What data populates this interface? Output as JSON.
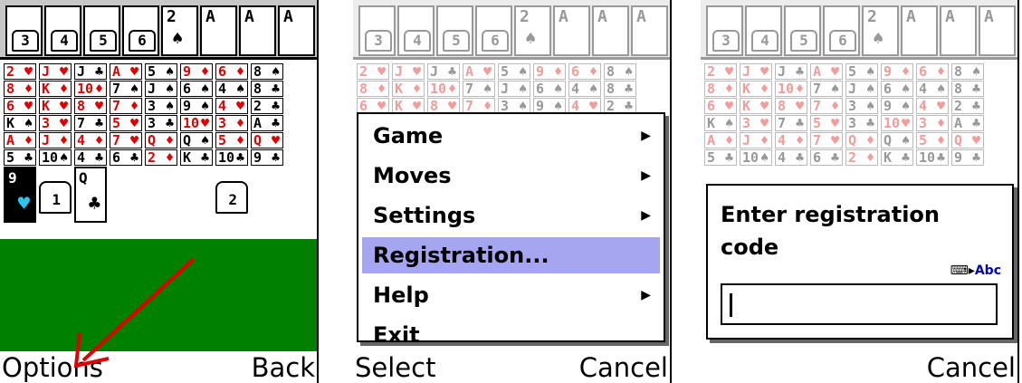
{
  "foundations": [
    {
      "n": "3"
    },
    {
      "n": "4"
    },
    {
      "n": "5"
    },
    {
      "n": "6"
    },
    {
      "rank": "2",
      "suit": "♠"
    },
    {
      "rank": "A"
    },
    {
      "rank": "A"
    },
    {
      "rank": "A"
    }
  ],
  "rows": [
    [
      [
        "2",
        "♥",
        "red"
      ],
      [
        "J",
        "♥",
        "red"
      ],
      [
        "J",
        "♣",
        "blk"
      ],
      [
        "A",
        "♥",
        "red"
      ],
      [
        "5",
        "♠",
        "blk"
      ],
      [
        "9",
        "♦",
        "red"
      ],
      [
        "6",
        "♦",
        "red"
      ],
      [
        "8",
        "♠",
        "blk"
      ]
    ],
    [
      [
        "8",
        "♦",
        "red"
      ],
      [
        "K",
        "♦",
        "red"
      ],
      [
        "10",
        "♦",
        "red"
      ],
      [
        "7",
        "♠",
        "blk"
      ],
      [
        "J",
        "♠",
        "blk"
      ],
      [
        "6",
        "♠",
        "blk"
      ],
      [
        "4",
        "♠",
        "blk"
      ],
      [
        "8",
        "♣",
        "blk"
      ]
    ],
    [
      [
        "6",
        "♥",
        "red"
      ],
      [
        "K",
        "♥",
        "red"
      ],
      [
        "8",
        "♥",
        "red"
      ],
      [
        "7",
        "♦",
        "red"
      ],
      [
        "3",
        "♠",
        "blk"
      ],
      [
        "9",
        "♠",
        "blk"
      ],
      [
        "4",
        "♥",
        "red"
      ],
      [
        "2",
        "♣",
        "blk"
      ]
    ],
    [
      [
        "K",
        "♠",
        "blk"
      ],
      [
        "3",
        "♥",
        "red"
      ],
      [
        "7",
        "♣",
        "blk"
      ],
      [
        "5",
        "♥",
        "red"
      ],
      [
        "3",
        "♣",
        "blk"
      ],
      [
        "10",
        "♥",
        "red"
      ],
      [
        "3",
        "♦",
        "red"
      ],
      [
        "A",
        "♣",
        "blk"
      ]
    ],
    [
      [
        "A",
        "♦",
        "red"
      ],
      [
        "J",
        "♦",
        "red"
      ],
      [
        "4",
        "♦",
        "red"
      ],
      [
        "7",
        "♥",
        "red"
      ],
      [
        "Q",
        "♦",
        "red"
      ],
      [
        "Q",
        "♠",
        "blk"
      ],
      [
        "5",
        "♦",
        "red"
      ],
      [
        "Q",
        "♥",
        "red"
      ]
    ],
    [
      [
        "5",
        "♣",
        "blk"
      ],
      [
        "10",
        "♠",
        "blk"
      ],
      [
        "4",
        "♣",
        "blk"
      ],
      [
        "6",
        "♣",
        "blk"
      ],
      [
        "2",
        "♦",
        "red"
      ],
      [
        "K",
        "♣",
        "blk"
      ],
      [
        "10",
        "♣",
        "blk"
      ],
      [
        "9",
        "♣",
        "blk"
      ]
    ]
  ],
  "bottom_cards": [
    {
      "rank": "9",
      "suit": "♥",
      "style": "selected"
    },
    {
      "rank": "",
      "suit": "1",
      "style": "slot"
    },
    {
      "rank": "Q",
      "suit": "♣",
      "style": "card"
    },
    {
      "rank": "",
      "suit": "",
      "style": "none"
    },
    {
      "rank": "",
      "suit": "",
      "style": "none"
    },
    {
      "rank": "",
      "suit": "",
      "style": "none"
    },
    {
      "rank": "",
      "suit": "2",
      "style": "slot"
    },
    {
      "rank": "",
      "suit": "",
      "style": "none"
    }
  ],
  "screen1": {
    "soft_left": "Options",
    "soft_right": "Back"
  },
  "screen2": {
    "menu": [
      {
        "label": "Game",
        "submenu": true
      },
      {
        "label": "Moves",
        "submenu": true
      },
      {
        "label": "Settings",
        "submenu": true
      },
      {
        "label": "Registration...",
        "submenu": false,
        "selected": true
      },
      {
        "label": "Help",
        "submenu": true
      },
      {
        "label": "Exit",
        "submenu": false
      }
    ],
    "soft_left": "Select",
    "soft_right": "Cancel"
  },
  "screen3": {
    "dialog_title": "Enter registration code",
    "input_mode": "Abc",
    "input_value": "",
    "soft_right": "Cancel"
  },
  "colors": {
    "felt": "#008000",
    "red_suit": "#e00000",
    "menu_highlight": "#a6a6f0",
    "arrow": "#e00000"
  }
}
